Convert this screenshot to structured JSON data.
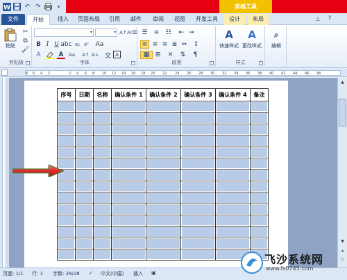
{
  "titlebar": {
    "context_label": "表格工具",
    "qat": [
      "save-icon",
      "undo-icon",
      "redo-icon",
      "print-icon"
    ]
  },
  "tabs": [
    {
      "id": "file",
      "label": "文件"
    },
    {
      "id": "home",
      "label": "开始"
    },
    {
      "id": "insert",
      "label": "插入"
    },
    {
      "id": "page-layout",
      "label": "页面布局"
    },
    {
      "id": "references",
      "label": "引用"
    },
    {
      "id": "mailings",
      "label": "邮件"
    },
    {
      "id": "review",
      "label": "审阅"
    },
    {
      "id": "view",
      "label": "视图"
    },
    {
      "id": "developer",
      "label": "开发工具"
    },
    {
      "id": "design",
      "label": "设计"
    },
    {
      "id": "layout",
      "label": "布局"
    }
  ],
  "ribbon": {
    "clipboard": {
      "label": "剪贴板",
      "paste_label": "粘贴"
    },
    "font": {
      "label": "字体",
      "bold": "B",
      "italic": "I",
      "underline": "U",
      "font_a": "A"
    },
    "paragraph": {
      "label": "段落"
    },
    "styles": {
      "label": "样式",
      "quick_styles": "快速样式",
      "change_styles": "更改样式"
    },
    "editing": {
      "label": "编辑"
    }
  },
  "ruler": {
    "ticks": [
      "8",
      "6",
      "4",
      "2",
      "2",
      "4",
      "6",
      "8",
      "10",
      "12",
      "14",
      "16",
      "18",
      "20",
      "22",
      "24",
      "26",
      "28",
      "30",
      "32",
      "34",
      "36",
      "38",
      "40",
      "42",
      "44",
      "46",
      "48"
    ]
  },
  "table": {
    "headers": [
      "序号",
      "日期",
      "名称",
      "确认条件 1",
      "确认条件 2",
      "确认条件 3",
      "确认条件 4",
      "备注"
    ],
    "row_count": 14,
    "fill_color": "#b8cce8"
  },
  "arrow_color": "#d92b2b",
  "statusbar": {
    "page": "页面: 1/1",
    "line": "行: 1",
    "words": "字数: 28/28",
    "language": "中文(中国)",
    "mode": "插入"
  },
  "watermark": {
    "title": "飞沙系统网",
    "url": "www.fs0745.com"
  }
}
